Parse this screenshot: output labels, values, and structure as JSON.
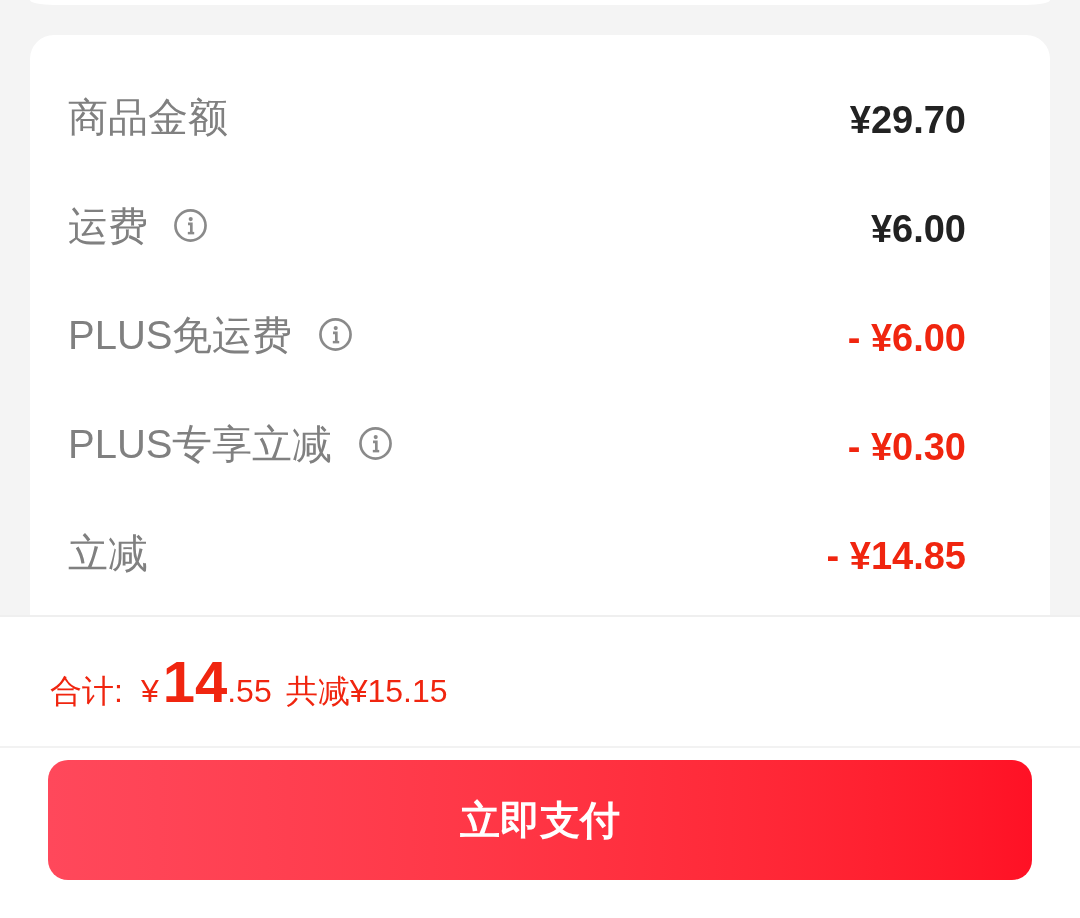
{
  "price_details": {
    "rows": [
      {
        "label": "商品金额",
        "info": false,
        "kind": "charge",
        "amount": "¥29.70"
      },
      {
        "label": "运费",
        "info": true,
        "kind": "charge",
        "amount": "¥6.00"
      },
      {
        "label": "PLUS免运费",
        "info": true,
        "kind": "discount",
        "amount": "- ¥6.00"
      },
      {
        "label": "PLUS专享立减",
        "info": true,
        "kind": "discount",
        "amount": "- ¥0.30"
      },
      {
        "label": "立减",
        "info": false,
        "kind": "discount",
        "amount": "- ¥14.85"
      }
    ]
  },
  "summary": {
    "total_label": "合计:",
    "currency": "¥",
    "total_integer": "14",
    "total_decimal": ".55",
    "discount_text": "共减¥15.15"
  },
  "pay_button": {
    "label": "立即支付"
  }
}
